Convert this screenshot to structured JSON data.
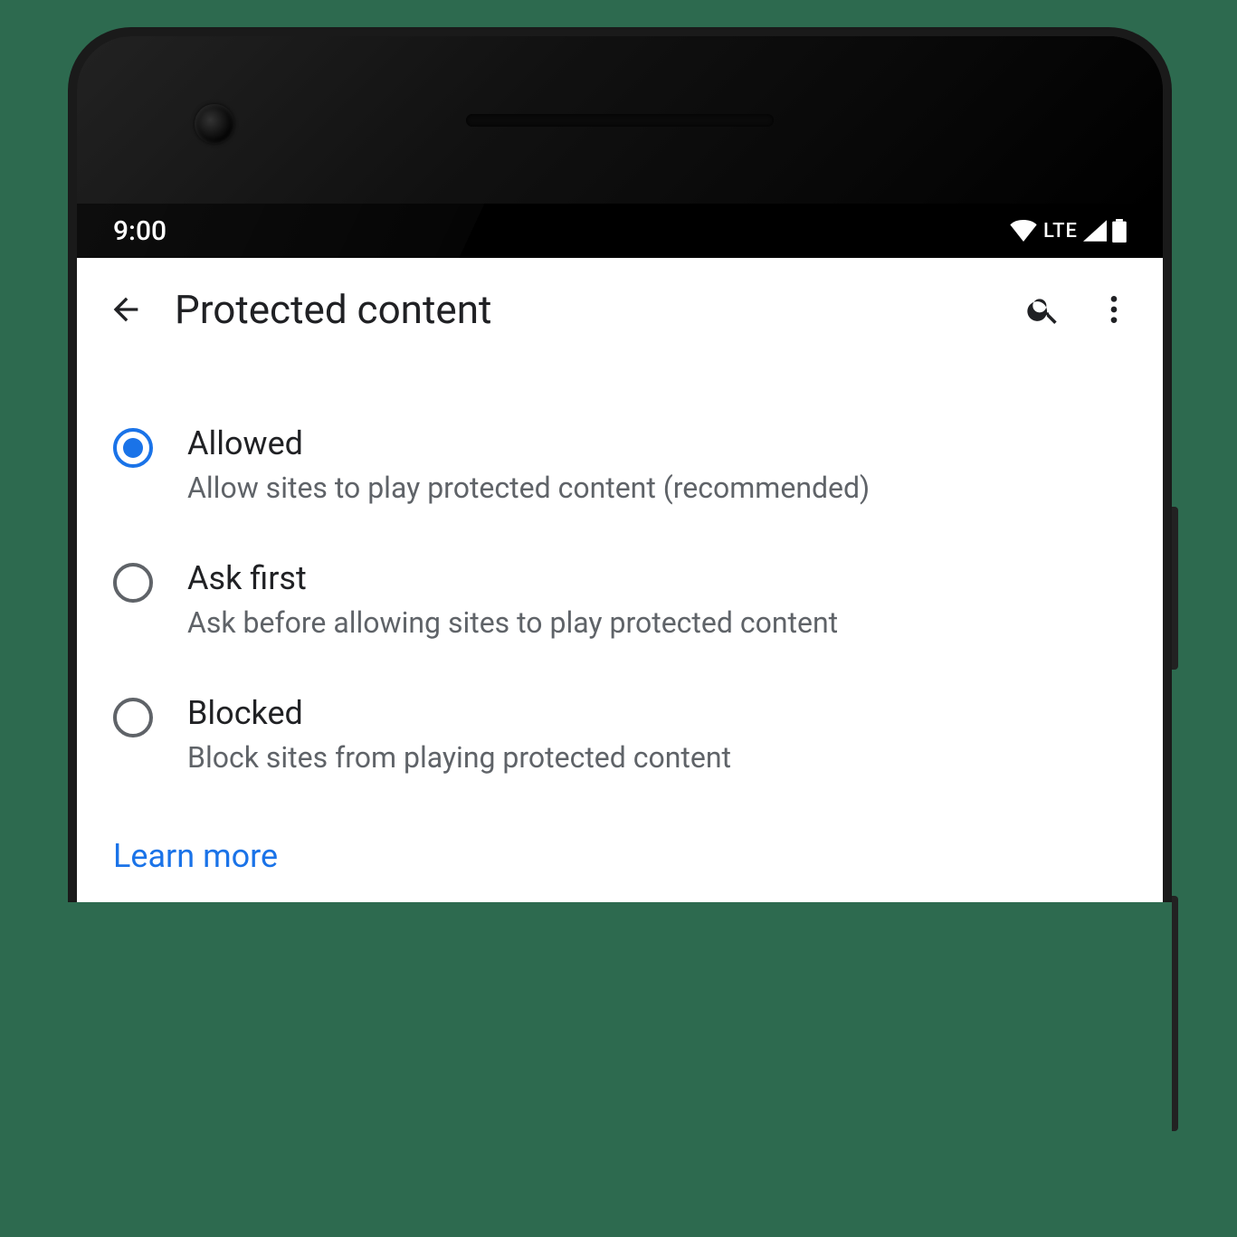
{
  "status_bar": {
    "time": "9:00",
    "network_label": "LTE"
  },
  "app_bar": {
    "title": "Protected content"
  },
  "options": [
    {
      "id": "allowed",
      "title": "Allowed",
      "desc": "Allow sites to play protected content (recommended)",
      "selected": true
    },
    {
      "id": "ask_first",
      "title": "Ask first",
      "desc": "Ask before allowing sites to play protected content",
      "selected": false
    },
    {
      "id": "blocked",
      "title": "Blocked",
      "desc": "Block sites from playing protected content",
      "selected": false
    }
  ],
  "learn_more_label": "Learn more",
  "colors": {
    "accent": "#1a73e8",
    "text_primary": "#202124",
    "text_secondary": "#5f6368"
  }
}
